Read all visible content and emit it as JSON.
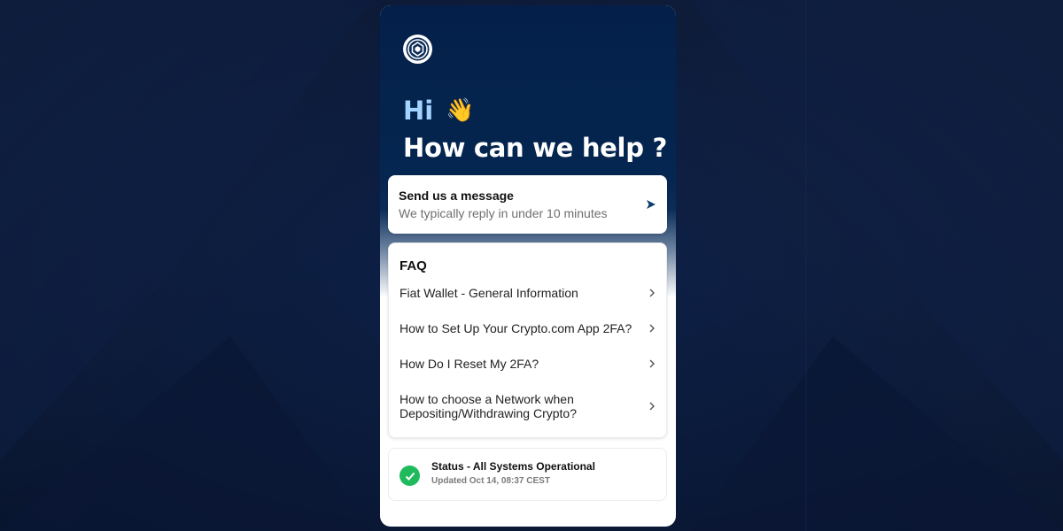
{
  "header": {
    "greeting": "Hi",
    "wave_emoji": "👋",
    "headline": "How can we help ?"
  },
  "message_card": {
    "title": "Send us a message",
    "subtitle": "We typically reply in under 10 minutes"
  },
  "faq": {
    "title": "FAQ",
    "items": [
      {
        "label": "Fiat Wallet - General Information"
      },
      {
        "label": "How to Set Up Your Crypto.com App 2FA?"
      },
      {
        "label": "How Do I Reset My 2FA?"
      },
      {
        "label": "How to choose a Network when Depositing/Withdrawing Crypto?"
      }
    ]
  },
  "status": {
    "title": "Status - All Systems Operational",
    "updated": "Updated Oct 14, 08:37 CEST"
  },
  "icons": {
    "logo": "crypto-com-logo",
    "send": "send-arrow-icon",
    "chevron": "chevron-right-icon",
    "status": "check-circle-icon"
  },
  "colors": {
    "hero_bg": "#04204a",
    "greeting": "#a3d4ff",
    "status_green": "#1fba5c",
    "send_arrow": "#0b3d6e"
  }
}
